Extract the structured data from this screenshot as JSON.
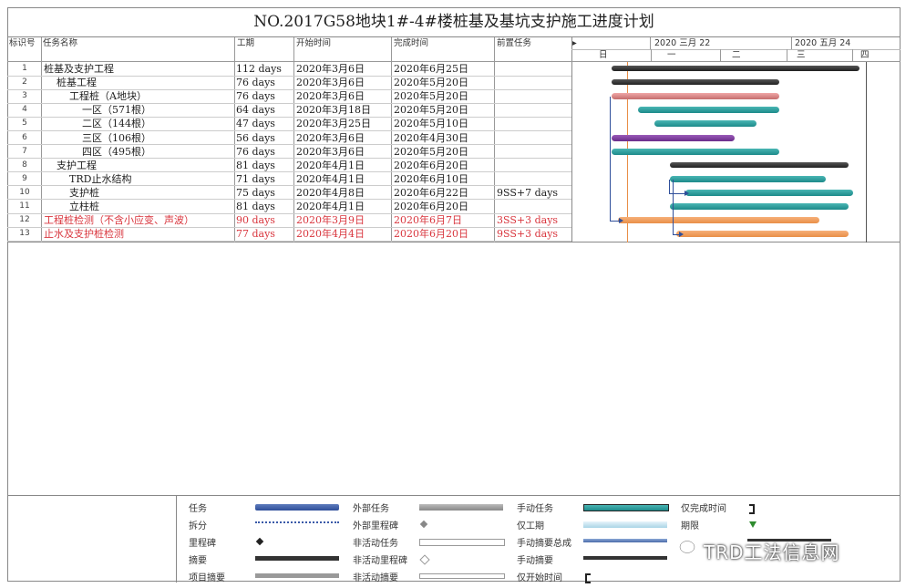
{
  "title": "NO.2017G58地块1#-4#楼桩基及基坑支护施工进度计划",
  "columns": {
    "id": "标识号",
    "name": "任务名称",
    "duration": "工期",
    "start": "开始时间",
    "finish": "完成时间",
    "pred": "前置任务"
  },
  "timescale": {
    "top": [
      "2020 三月 22",
      "2020 五月 24"
    ],
    "bottom": [
      "日",
      "一",
      "二",
      "三",
      "四"
    ]
  },
  "tasks": [
    {
      "id": "1",
      "name": "桩基及支护工程",
      "duration": "112 days",
      "start": "2020年3月6日",
      "finish": "2020年6月25日",
      "pred": "",
      "indent": 0,
      "red": false
    },
    {
      "id": "2",
      "name": "桩基工程",
      "duration": "76 days",
      "start": "2020年3月6日",
      "finish": "2020年5月20日",
      "pred": "",
      "indent": 1,
      "red": false
    },
    {
      "id": "3",
      "name": "工程桩（A地块）",
      "duration": "76 days",
      "start": "2020年3月6日",
      "finish": "2020年5月20日",
      "pred": "",
      "indent": 2,
      "red": false
    },
    {
      "id": "4",
      "name": "一区（571根）",
      "duration": "64 days",
      "start": "2020年3月18日",
      "finish": "2020年5月20日",
      "pred": "",
      "indent": 3,
      "red": false
    },
    {
      "id": "5",
      "name": "二区（144根）",
      "duration": "47 days",
      "start": "2020年3月25日",
      "finish": "2020年5月10日",
      "pred": "",
      "indent": 3,
      "red": false
    },
    {
      "id": "6",
      "name": "三区（106根）",
      "duration": "56 days",
      "start": "2020年3月6日",
      "finish": "2020年4月30日",
      "pred": "",
      "indent": 3,
      "red": false
    },
    {
      "id": "7",
      "name": "四区（495根）",
      "duration": "76 days",
      "start": "2020年3月6日",
      "finish": "2020年5月20日",
      "pred": "",
      "indent": 3,
      "red": false
    },
    {
      "id": "8",
      "name": "支护工程",
      "duration": "81 days",
      "start": "2020年4月1日",
      "finish": "2020年6月20日",
      "pred": "",
      "indent": 1,
      "red": false
    },
    {
      "id": "9",
      "name": "TRD止水结构",
      "duration": "71 days",
      "start": "2020年4月1日",
      "finish": "2020年6月10日",
      "pred": "",
      "indent": 2,
      "red": false
    },
    {
      "id": "10",
      "name": "支护桩",
      "duration": "75 days",
      "start": "2020年4月8日",
      "finish": "2020年6月22日",
      "pred": "9SS+7 days",
      "indent": 2,
      "red": false
    },
    {
      "id": "11",
      "name": "立柱桩",
      "duration": "81 days",
      "start": "2020年4月1日",
      "finish": "2020年6月20日",
      "pred": "",
      "indent": 2,
      "red": false
    },
    {
      "id": "12",
      "name": "工程桩检测（不含小应变、声波）",
      "duration": "90 days",
      "start": "2020年3月9日",
      "finish": "2020年6月7日",
      "pred": "3SS+3 days",
      "indent": 0,
      "red": true
    },
    {
      "id": "13",
      "name": "止水及支护桩检测",
      "duration": "77 days",
      "start": "2020年4月4日",
      "finish": "2020年6月20日",
      "pred": "9SS+3 days",
      "indent": 0,
      "red": true
    }
  ],
  "gantt_bars": [
    {
      "task": "1",
      "style": "dark",
      "start_day": "2020-03-06",
      "end_day": "2020-06-25"
    },
    {
      "task": "2",
      "style": "dark",
      "start_day": "2020-03-06",
      "end_day": "2020-05-20"
    },
    {
      "task": "3",
      "style": "pinkfill",
      "start_day": "2020-03-06",
      "end_day": "2020-05-20"
    },
    {
      "task": "4",
      "style": "teal",
      "start_day": "2020-03-18",
      "end_day": "2020-05-20"
    },
    {
      "task": "5",
      "style": "teal",
      "start_day": "2020-03-25",
      "end_day": "2020-05-10"
    },
    {
      "task": "6",
      "style": "purple",
      "start_day": "2020-03-06",
      "end_day": "2020-04-30"
    },
    {
      "task": "7",
      "style": "teal",
      "start_day": "2020-03-06",
      "end_day": "2020-05-20"
    },
    {
      "task": "8",
      "style": "dark",
      "start_day": "2020-04-01",
      "end_day": "2020-06-20"
    },
    {
      "task": "9",
      "style": "teal",
      "start_day": "2020-04-01",
      "end_day": "2020-06-10"
    },
    {
      "task": "10",
      "style": "teal",
      "start_day": "2020-04-08",
      "end_day": "2020-06-22"
    },
    {
      "task": "11",
      "style": "teal",
      "start_day": "2020-04-01",
      "end_day": "2020-06-20"
    },
    {
      "task": "12",
      "style": "orange",
      "start_day": "2020-03-09",
      "end_day": "2020-06-07"
    },
    {
      "task": "13",
      "style": "orange",
      "start_day": "2020-04-04",
      "end_day": "2020-06-20"
    }
  ],
  "legend": [
    {
      "label": "任务",
      "symbol": "task"
    },
    {
      "label": "拆分",
      "symbol": "split"
    },
    {
      "label": "里程碑",
      "symbol": "milestone"
    },
    {
      "label": "摘要",
      "symbol": "summary"
    },
    {
      "label": "项目摘要",
      "symbol": "project-summary"
    },
    {
      "label": "外部任务",
      "symbol": "external-task"
    },
    {
      "label": "外部里程碑",
      "symbol": "external-milestone"
    },
    {
      "label": "非活动任务",
      "symbol": "inactive-task"
    },
    {
      "label": "非活动里程碑",
      "symbol": "inactive-milestone"
    },
    {
      "label": "非活动摘要",
      "symbol": "inactive-summary"
    },
    {
      "label": "手动任务",
      "symbol": "manual-task"
    },
    {
      "label": "仅工期",
      "symbol": "duration-only"
    },
    {
      "label": "手动摘要总成",
      "symbol": "manual-summary-rollup"
    },
    {
      "label": "手动摘要",
      "symbol": "manual-summary"
    },
    {
      "label": "仅开始时间",
      "symbol": "start-only"
    },
    {
      "label": "仅完成时间",
      "symbol": "finish-only"
    },
    {
      "label": "期限",
      "symbol": "deadline"
    },
    {
      "label": "",
      "symbol": "progress"
    }
  ],
  "watermark": "TRD工法信息网",
  "colors": {
    "teal": "#2a9d9c",
    "orange": "#ec9a5a",
    "purple": "#7b3a9c",
    "red_text": "#d9363e",
    "today_line": "#e98f47"
  }
}
